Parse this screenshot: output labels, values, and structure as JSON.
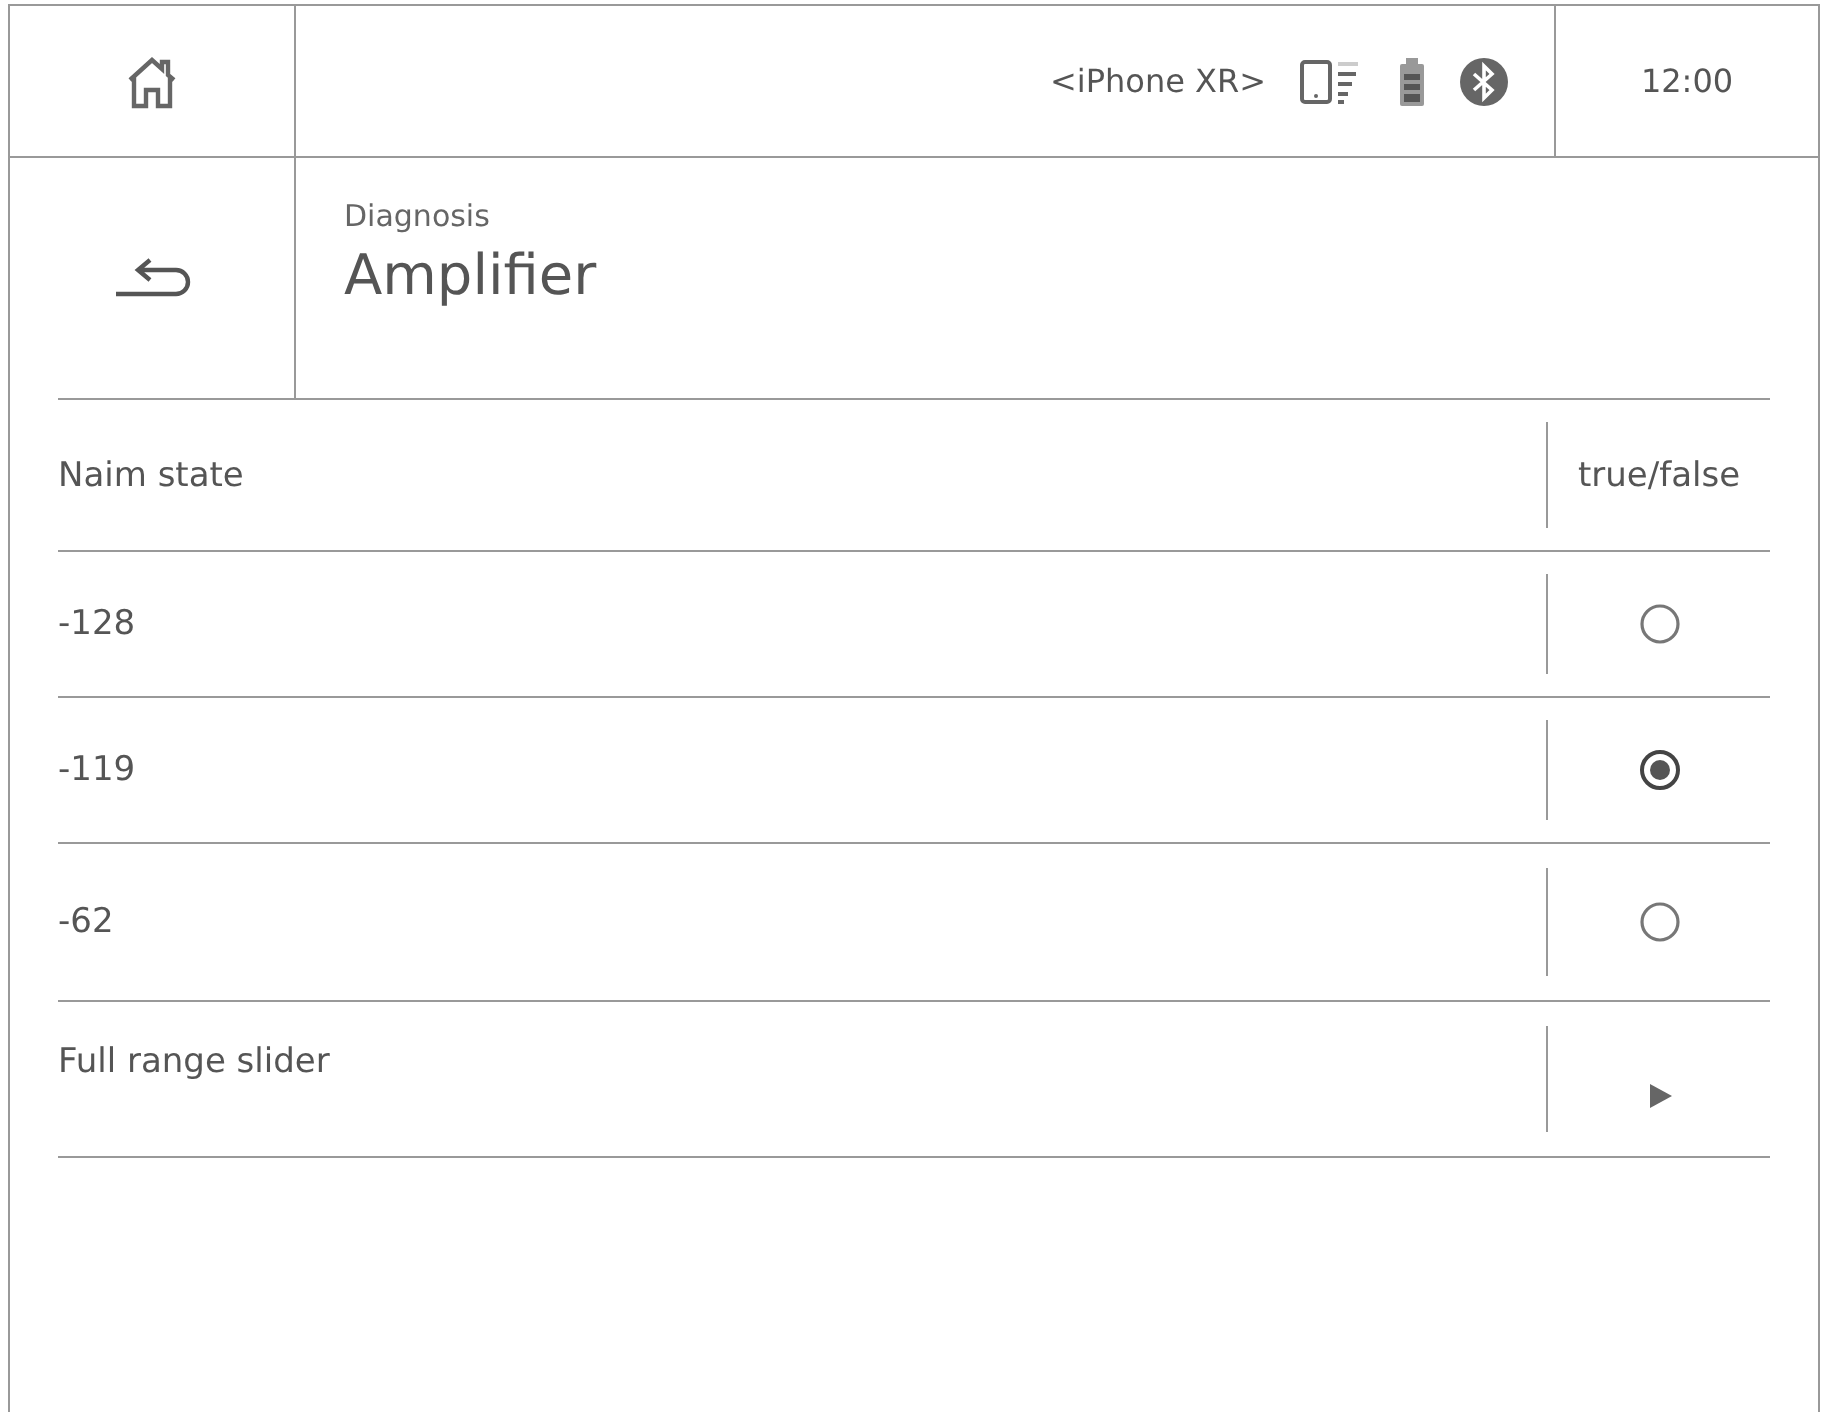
{
  "status_bar": {
    "device": "<iPhone XR>",
    "time": "12:00"
  },
  "header": {
    "section": "Diagnosis",
    "title": "Amplifier"
  },
  "table": {
    "columns": [
      "Naim state",
      "true/false"
    ],
    "rows": [
      {
        "kind": "radio",
        "label": "-128",
        "selected": false
      },
      {
        "kind": "radio",
        "label": "-119",
        "selected": true
      },
      {
        "kind": "radio",
        "label": "-62",
        "selected": false
      },
      {
        "kind": "link",
        "label": "Full range slider"
      }
    ]
  }
}
